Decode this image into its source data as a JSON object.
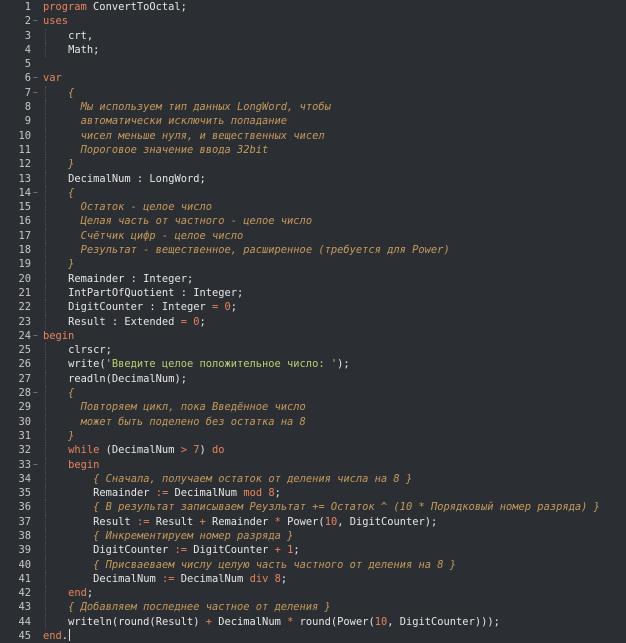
{
  "editor": {
    "language": "pascal",
    "colors": {
      "background": "#2b2e33",
      "keyword": "#e8835c",
      "string": "#b9cf72",
      "comment": "#c59a5c",
      "identifier": "#e6e6e6",
      "line_number": "#c8c8c8"
    },
    "lines": [
      {
        "n": "1",
        "fold": "",
        "indent": 0,
        "tokens": [
          [
            "kw",
            "program"
          ],
          [
            "id",
            " ConvertToOctal"
          ],
          [
            "punct",
            ";"
          ]
        ]
      },
      {
        "n": "2",
        "fold": "-",
        "indent": 0,
        "tokens": [
          [
            "kw",
            "uses"
          ]
        ]
      },
      {
        "n": "3",
        "fold": "",
        "indent": 2,
        "tokens": [
          [
            "id",
            "crt"
          ],
          [
            "punct",
            ","
          ]
        ]
      },
      {
        "n": "4",
        "fold": "",
        "indent": 2,
        "tokens": [
          [
            "id",
            "Math"
          ],
          [
            "punct",
            ";"
          ]
        ]
      },
      {
        "n": "5",
        "fold": "",
        "indent": 0,
        "tokens": []
      },
      {
        "n": "6",
        "fold": "-",
        "indent": 0,
        "tokens": [
          [
            "kw",
            "var"
          ]
        ]
      },
      {
        "n": "7",
        "fold": "-",
        "indent": 2,
        "tokens": [
          [
            "cmt",
            "{"
          ]
        ]
      },
      {
        "n": "8",
        "fold": "",
        "indent": 3,
        "tokens": [
          [
            "cmt",
            "Мы используем тип данных LongWord, чтобы"
          ]
        ]
      },
      {
        "n": "9",
        "fold": "",
        "indent": 3,
        "tokens": [
          [
            "cmt",
            "автоматически исключить попадание"
          ]
        ]
      },
      {
        "n": "10",
        "fold": "",
        "indent": 3,
        "tokens": [
          [
            "cmt",
            "чисел меньше нуля, и вещественных чисел"
          ]
        ]
      },
      {
        "n": "11",
        "fold": "",
        "indent": 3,
        "tokens": [
          [
            "cmt",
            "Пороговое значение ввода 32bit"
          ]
        ]
      },
      {
        "n": "12",
        "fold": "",
        "indent": 2,
        "tokens": [
          [
            "cmt",
            "}"
          ]
        ]
      },
      {
        "n": "13",
        "fold": "",
        "indent": 2,
        "tokens": [
          [
            "id",
            "DecimalNum "
          ],
          [
            "punct",
            ":"
          ],
          [
            "id",
            " LongWord"
          ],
          [
            "punct",
            ";"
          ]
        ]
      },
      {
        "n": "14",
        "fold": "-",
        "indent": 2,
        "tokens": [
          [
            "cmt",
            "{"
          ]
        ]
      },
      {
        "n": "15",
        "fold": "",
        "indent": 3,
        "tokens": [
          [
            "cmt",
            "Остаток - целое число"
          ]
        ]
      },
      {
        "n": "16",
        "fold": "",
        "indent": 3,
        "tokens": [
          [
            "cmt",
            "Целая часть от частного - целое число"
          ]
        ]
      },
      {
        "n": "17",
        "fold": "",
        "indent": 3,
        "tokens": [
          [
            "cmt",
            "Счётчик цифр - целое число"
          ]
        ]
      },
      {
        "n": "18",
        "fold": "",
        "indent": 3,
        "tokens": [
          [
            "cmt",
            "Результат - вещественное, расширенное (требуется для Power)"
          ]
        ]
      },
      {
        "n": "19",
        "fold": "",
        "indent": 2,
        "tokens": [
          [
            "cmt",
            "}"
          ]
        ]
      },
      {
        "n": "20",
        "fold": "",
        "indent": 2,
        "tokens": [
          [
            "id",
            "Remainder "
          ],
          [
            "punct",
            ":"
          ],
          [
            "id",
            " Integer"
          ],
          [
            "punct",
            ";"
          ]
        ]
      },
      {
        "n": "21",
        "fold": "",
        "indent": 2,
        "tokens": [
          [
            "id",
            "IntPartOfQuotient "
          ],
          [
            "punct",
            ":"
          ],
          [
            "id",
            " Integer"
          ],
          [
            "punct",
            ";"
          ]
        ]
      },
      {
        "n": "22",
        "fold": "",
        "indent": 2,
        "tokens": [
          [
            "id",
            "DigitCounter "
          ],
          [
            "punct",
            ":"
          ],
          [
            "id",
            " Integer "
          ],
          [
            "op",
            "="
          ],
          [
            "num",
            " 0"
          ],
          [
            "punct",
            ";"
          ]
        ]
      },
      {
        "n": "23",
        "fold": "",
        "indent": 2,
        "tokens": [
          [
            "id",
            "Result "
          ],
          [
            "punct",
            ":"
          ],
          [
            "id",
            " Extended "
          ],
          [
            "op",
            "="
          ],
          [
            "num",
            " 0"
          ],
          [
            "punct",
            ";"
          ]
        ]
      },
      {
        "n": "24",
        "fold": "-",
        "indent": 0,
        "tokens": [
          [
            "kw",
            "begin"
          ]
        ]
      },
      {
        "n": "25",
        "fold": "",
        "indent": 2,
        "tokens": [
          [
            "id",
            "clrscr"
          ],
          [
            "punct",
            ";"
          ]
        ]
      },
      {
        "n": "26",
        "fold": "",
        "indent": 2,
        "tokens": [
          [
            "id",
            "write"
          ],
          [
            "punct",
            "("
          ],
          [
            "str",
            "'Введите целое положительное число: '"
          ],
          [
            "punct",
            ");"
          ]
        ]
      },
      {
        "n": "27",
        "fold": "",
        "indent": 2,
        "tokens": [
          [
            "id",
            "readln"
          ],
          [
            "punct",
            "("
          ],
          [
            "id",
            "DecimalNum"
          ],
          [
            "punct",
            ");"
          ]
        ]
      },
      {
        "n": "28",
        "fold": "-",
        "indent": 2,
        "tokens": [
          [
            "cmt",
            "{"
          ]
        ]
      },
      {
        "n": "29",
        "fold": "",
        "indent": 3,
        "tokens": [
          [
            "cmt",
            "Повторяем цикл, пока Введённое число"
          ]
        ]
      },
      {
        "n": "30",
        "fold": "",
        "indent": 3,
        "tokens": [
          [
            "cmt",
            "может быть поделено без остатка на 8"
          ]
        ]
      },
      {
        "n": "31",
        "fold": "",
        "indent": 2,
        "tokens": [
          [
            "cmt",
            "}"
          ]
        ]
      },
      {
        "n": "32",
        "fold": "",
        "indent": 2,
        "tokens": [
          [
            "kw",
            "while"
          ],
          [
            "id",
            " "
          ],
          [
            "punct",
            "("
          ],
          [
            "id",
            "DecimalNum "
          ],
          [
            "op",
            ">"
          ],
          [
            "num",
            " 7"
          ],
          [
            "punct",
            ") "
          ],
          [
            "kw",
            "do"
          ]
        ]
      },
      {
        "n": "33",
        "fold": "-",
        "indent": 2,
        "tokens": [
          [
            "kw",
            "begin"
          ]
        ]
      },
      {
        "n": "34",
        "fold": "",
        "indent": 4,
        "tokens": [
          [
            "cmt",
            "{ Сначала, получаем остаток от деления числа на 8 }"
          ]
        ]
      },
      {
        "n": "35",
        "fold": "",
        "indent": 4,
        "tokens": [
          [
            "id",
            "Remainder "
          ],
          [
            "op",
            ":="
          ],
          [
            "id",
            " DecimalNum "
          ],
          [
            "kw",
            "mod"
          ],
          [
            "num",
            " 8"
          ],
          [
            "punct",
            ";"
          ]
        ]
      },
      {
        "n": "36",
        "fold": "",
        "indent": 4,
        "tokens": [
          [
            "cmt",
            "{ В результат записываем Реузльтат += Остаток ^ (10 * Порядковый номер разряда) }"
          ]
        ]
      },
      {
        "n": "37",
        "fold": "",
        "indent": 4,
        "tokens": [
          [
            "id",
            "Result "
          ],
          [
            "op",
            ":="
          ],
          [
            "id",
            " Result "
          ],
          [
            "op",
            "+"
          ],
          [
            "id",
            " Remainder "
          ],
          [
            "op",
            "*"
          ],
          [
            "id",
            " Power"
          ],
          [
            "punct",
            "("
          ],
          [
            "num",
            "10"
          ],
          [
            "punct",
            ", "
          ],
          [
            "id",
            "DigitCounter"
          ],
          [
            "punct",
            ");"
          ]
        ]
      },
      {
        "n": "38",
        "fold": "",
        "indent": 4,
        "tokens": [
          [
            "cmt",
            "{ Инкрементируем номер разряда }"
          ]
        ]
      },
      {
        "n": "39",
        "fold": "",
        "indent": 4,
        "tokens": [
          [
            "id",
            "DigitCounter "
          ],
          [
            "op",
            ":="
          ],
          [
            "id",
            " DigitCounter "
          ],
          [
            "op",
            "+"
          ],
          [
            "num",
            " 1"
          ],
          [
            "punct",
            ";"
          ]
        ]
      },
      {
        "n": "40",
        "fold": "",
        "indent": 4,
        "tokens": [
          [
            "cmt",
            "{ Присваеваем числу целую часть частного от деления на 8 }"
          ]
        ]
      },
      {
        "n": "41",
        "fold": "",
        "indent": 4,
        "tokens": [
          [
            "id",
            "DecimalNum "
          ],
          [
            "op",
            ":="
          ],
          [
            "id",
            " DecimalNum "
          ],
          [
            "kw",
            "div"
          ],
          [
            "num",
            " 8"
          ],
          [
            "punct",
            ";"
          ]
        ]
      },
      {
        "n": "42",
        "fold": "",
        "indent": 2,
        "tokens": [
          [
            "kw",
            "end"
          ],
          [
            "punct",
            ";"
          ]
        ]
      },
      {
        "n": "43",
        "fold": "",
        "indent": 2,
        "tokens": [
          [
            "cmt",
            "{ Добавляем последнее частное от деления }"
          ]
        ]
      },
      {
        "n": "44",
        "fold": "",
        "indent": 2,
        "tokens": [
          [
            "id",
            "writeln"
          ],
          [
            "punct",
            "("
          ],
          [
            "id",
            "round"
          ],
          [
            "punct",
            "("
          ],
          [
            "id",
            "Result"
          ],
          [
            "punct",
            ") "
          ],
          [
            "op",
            "+"
          ],
          [
            "id",
            " DecimalNum "
          ],
          [
            "op",
            "*"
          ],
          [
            "id",
            " round"
          ],
          [
            "punct",
            "("
          ],
          [
            "id",
            "Power"
          ],
          [
            "punct",
            "("
          ],
          [
            "num",
            "10"
          ],
          [
            "punct",
            ", "
          ],
          [
            "id",
            "DigitCounter"
          ],
          [
            "punct",
            ")));"
          ]
        ]
      },
      {
        "n": "45",
        "fold": "",
        "indent": 0,
        "tokens": [
          [
            "kw",
            "end"
          ],
          [
            "punct",
            "."
          ]
        ],
        "caret": true
      }
    ]
  }
}
